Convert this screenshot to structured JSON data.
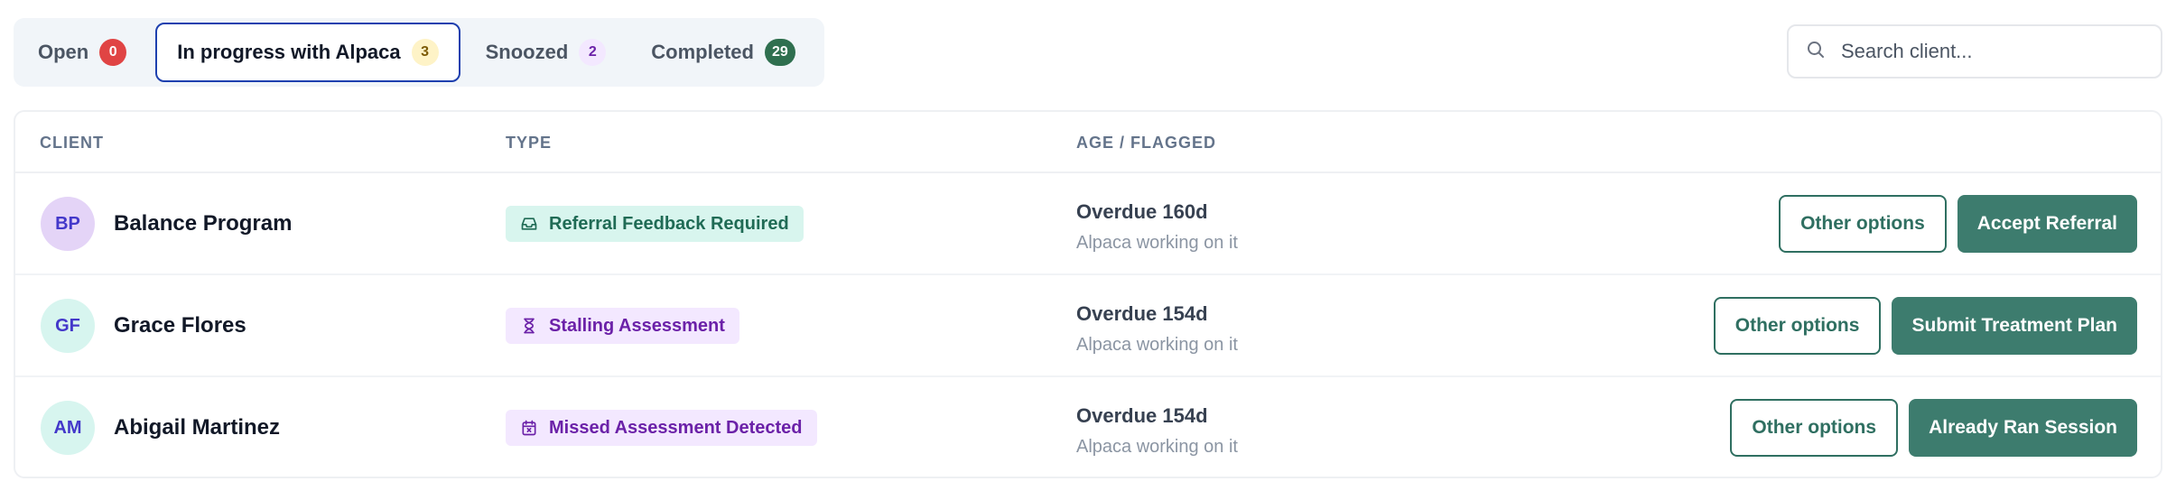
{
  "tabs": [
    {
      "label": "Open",
      "count": "0",
      "badge_color": "#e04444"
    },
    {
      "label": "In progress with Alpaca",
      "count": "3",
      "badge_color": "#fef3c7",
      "active": true
    },
    {
      "label": "Snoozed",
      "count": "2",
      "badge_color": "#f3e8ff"
    },
    {
      "label": "Completed",
      "count": "29",
      "badge_color": "#2f6f4f"
    }
  ],
  "search": {
    "placeholder": "Search client...",
    "icon": "search-icon"
  },
  "table": {
    "headers": {
      "client": "CLIENT",
      "type": "TYPE",
      "age": "AGE / FLAGGED"
    },
    "rows": [
      {
        "initials": "BP",
        "avatar_color": "#e4d4f7",
        "name": "Balance Program",
        "type": "Referral Feedback Required",
        "type_icon": "inbox-icon",
        "age": "Overdue 160d",
        "status": "Alpaca working on it",
        "secondary_action": "Other options",
        "primary_action": "Accept Referral"
      },
      {
        "initials": "GF",
        "avatar_color": "#d7f5ef",
        "name": "Grace Flores",
        "type": "Stalling Assessment",
        "type_icon": "hourglass-icon",
        "age": "Overdue 154d",
        "status": "Alpaca working on it",
        "secondary_action": "Other options",
        "primary_action": "Submit Treatment Plan"
      },
      {
        "initials": "AM",
        "avatar_color": "#d7f5ef",
        "name": "Abigail Martinez",
        "type": "Missed Assessment Detected",
        "type_icon": "calendar-x-icon",
        "age": "Overdue 154d",
        "status": "Alpaca working on it",
        "secondary_action": "Other options",
        "primary_action": "Already Ran Session"
      }
    ]
  },
  "colors": {
    "accent": "#3d7c6e",
    "active_tab_border": "#1e40af"
  }
}
